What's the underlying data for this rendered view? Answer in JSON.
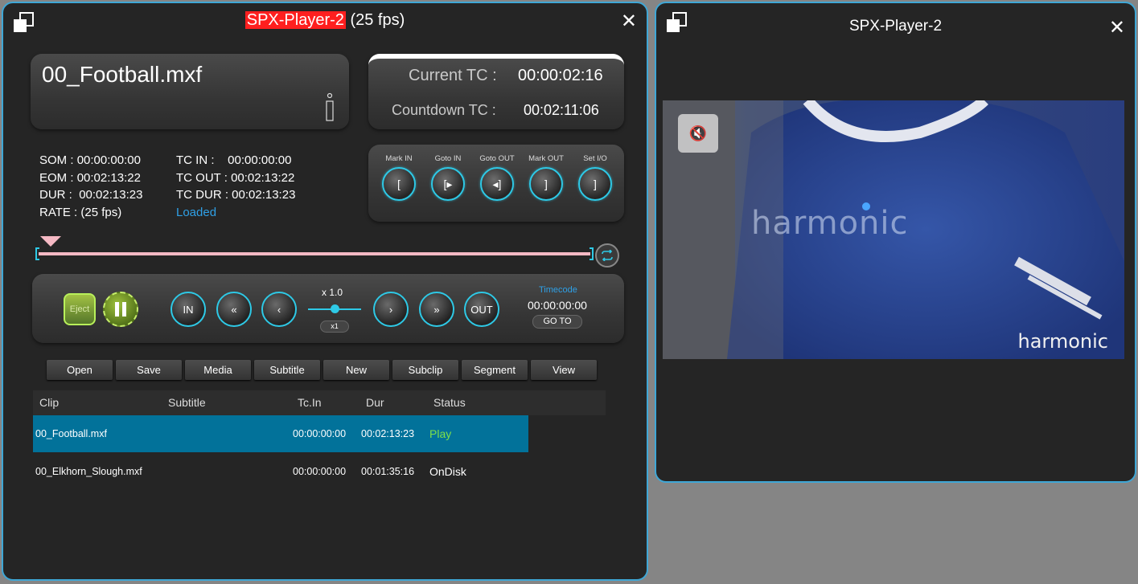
{
  "left_window": {
    "title_highlight": "SPX-Player-2",
    "title_suffix": "(25 fps)",
    "close_glyph": "✕",
    "file_name": "00_Football.mxf",
    "current_tc_label": "Current TC :",
    "current_tc_value": "00:00:02:16",
    "countdown_tc_label": "Countdown TC :",
    "countdown_tc_value": "00:02:11:06",
    "meta": {
      "som_label": "SOM :",
      "som": "00:00:00:00",
      "eom_label": "EOM :",
      "eom": "00:02:13:22",
      "dur_label": "DUR :",
      "dur": "00:02:13:23",
      "rate_label": "RATE :",
      "rate": "(25 fps)",
      "tcin_label": "TC IN :",
      "tcin": "00:00:00:00",
      "tcout_label": "TC OUT :",
      "tcout": "00:02:13:22",
      "tcdur_label": "TC DUR :",
      "tcdur": "00:02:13:23",
      "status": "Loaded"
    },
    "mark_buttons": [
      "Mark IN",
      "Goto IN",
      "Goto OUT",
      "Mark OUT",
      "Set I/O"
    ],
    "transport": {
      "eject_label": "Eject",
      "in_label": "IN",
      "out_label": "OUT",
      "speed_label": "x 1.0",
      "speed_reset": "x1",
      "timecode_label": "Timecode",
      "timecode_value": "00:00:00:00",
      "goto_label": "GO TO"
    },
    "tabs": [
      "Open",
      "Save",
      "Media",
      "Subtitle",
      "New",
      "Subclip",
      "Segment",
      "View"
    ],
    "table": {
      "headers": [
        "Clip",
        "Subtitle",
        "Tc.In",
        "Dur",
        "Status"
      ],
      "rows": [
        {
          "clip": "00_Football.mxf",
          "subtitle": "",
          "tcin": "00:00:00:00",
          "dur": "00:02:13:23",
          "status": "Play"
        },
        {
          "clip": "00_Elkhorn_Slough.mxf",
          "subtitle": "",
          "tcin": "00:00:00:00",
          "dur": "00:01:35:16",
          "status": "OnDisk"
        }
      ]
    }
  },
  "right_window": {
    "title": "SPX-Player-2",
    "close_glyph": "✕",
    "mute_icon": "🔇",
    "video_shirt_text": "harmonic",
    "video_logo_text": "harmonic"
  },
  "colors": {
    "accent": "#3fa7d6",
    "button_ring": "#2ec9e6",
    "title_highlight": "#ff1f1f",
    "selected_row": "#02729a",
    "play_status": "#7ee04a",
    "loaded_status": "#2fa0e6",
    "timeline": "#f5b9c4"
  }
}
